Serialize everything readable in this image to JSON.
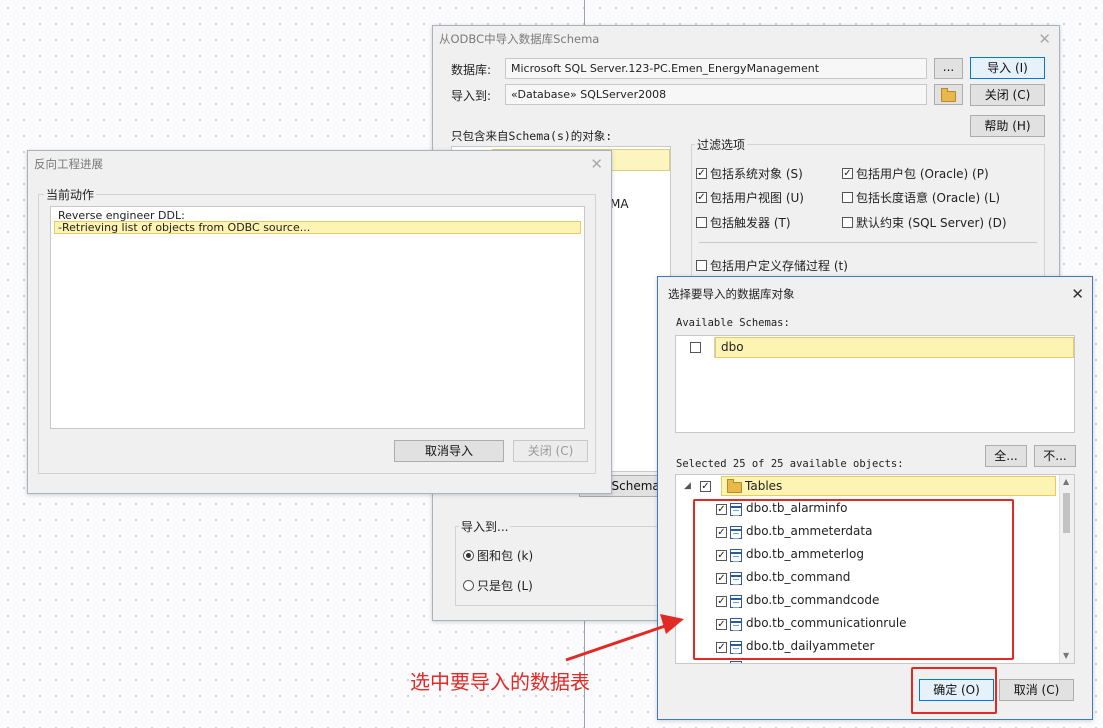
{
  "main_dialog": {
    "title": "从ODBC中导入数据库Schema",
    "database_label": "数据库:",
    "database_value": "Microsoft SQL Server.123-PC.Emen_EnergyManagement",
    "browse_label": "...",
    "import_to_label": "导入到:",
    "import_to_value": "«Database» SQLServer2008",
    "import_button": "导入 (I)",
    "close_button": "关闭 (C)",
    "help_button": "帮助 (H)",
    "schema_objects_label": "只包含来自Schema(s)的对象:",
    "schema_list_partial": "MA",
    "schemas_button_partial": "Schemas",
    "filter_title": "过滤选项",
    "filters": [
      {
        "label": "包括系统对象 (S)",
        "checked": true
      },
      {
        "label": "包括用户包 (Oracle) (P)",
        "checked": true
      },
      {
        "label": "包括用户视图 (U)",
        "checked": true
      },
      {
        "label": "包括长度语意 (Oracle) (L)",
        "checked": false
      },
      {
        "label": "包括触发器 (T)",
        "checked": false
      },
      {
        "label": "默认约束 (SQL Server) (D)",
        "checked": false
      },
      {
        "label": "包括用户定义存储过程 (t)",
        "checked": false
      }
    ],
    "import_to_group": "导入到...",
    "radio_diagram_package": "图和包 (k)",
    "radio_package_only": "只是包 (L)"
  },
  "progress_dialog": {
    "title": "反向工程进展",
    "current_action_label": "当前动作",
    "log_lines": [
      "Reverse engineer DDL:",
      "-Retrieving list of objects from ODBC source..."
    ],
    "cancel_button": "取消导入",
    "close_button": "关闭 (C)"
  },
  "select_dialog": {
    "title": "选择要导入的数据库对象",
    "available_schemas_label": "Available Schemas:",
    "schemas": [
      {
        "name": "dbo",
        "checked": false
      }
    ],
    "selected_label": "Selected 25 of 25 available objects:",
    "all_button": "全...",
    "none_button": "不...",
    "tree_root": "Tables",
    "tables": [
      "dbo.tb_alarminfo",
      "dbo.tb_ammeterdata",
      "dbo.tb_ammeterlog",
      "dbo.tb_command",
      "dbo.tb_commandcode",
      "dbo.tb_communicationrule",
      "dbo.tb_dailyammeter"
    ],
    "ok_button": "确定 (O)",
    "cancel_button": "取消 (C)"
  },
  "annotation": {
    "text": "选中要导入的数据表",
    "color": "#e22a24"
  }
}
